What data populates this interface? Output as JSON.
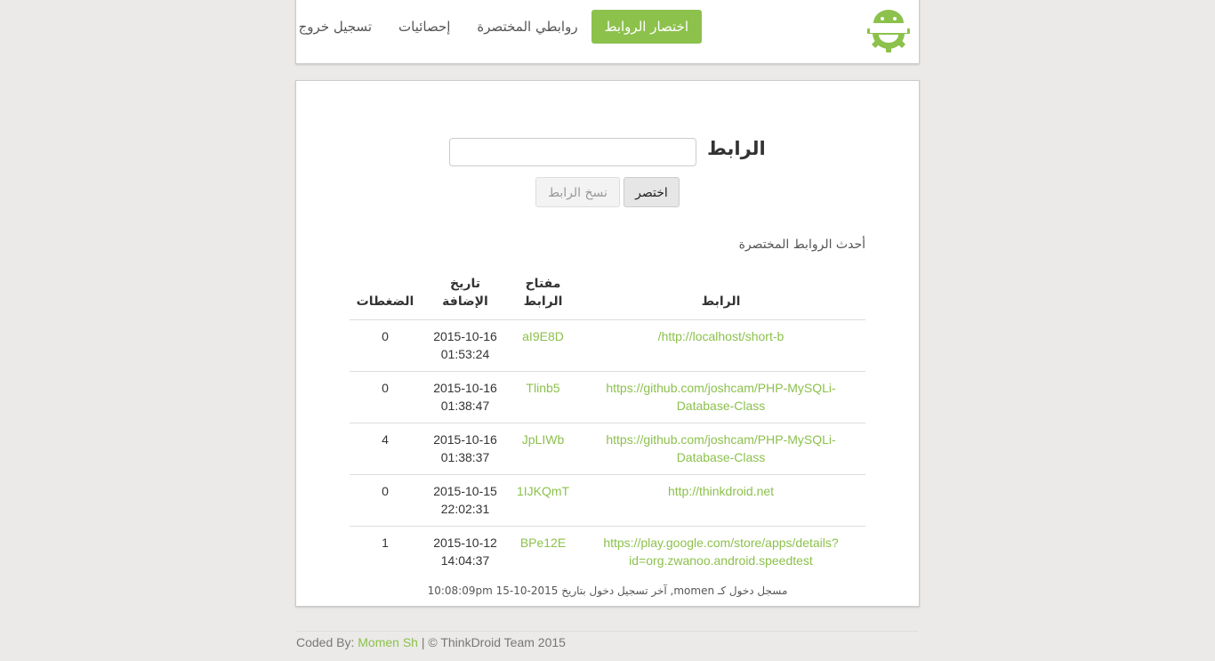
{
  "nav": {
    "logo_icon": "android-gear-logo-icon",
    "items": [
      {
        "label": "اختصار الروابط",
        "active": true
      },
      {
        "label": "روابطي المختصرة",
        "active": false
      },
      {
        "label": "إحصائيات",
        "active": false
      },
      {
        "label": "تسجيل خروج",
        "active": false
      }
    ]
  },
  "form": {
    "url_label": "الرابط",
    "url_value": "",
    "shorten_label": "اختصر",
    "copy_label": "نسخ الرابط"
  },
  "recent": {
    "title": "أحدث الروابط المختصرة",
    "headers": {
      "url": "الرابط",
      "key": "مفتاح الرابط",
      "date": "تاريخ الإضافة",
      "clicks": "الضغطات"
    },
    "rows": [
      {
        "url": "http://localhost/short-b/",
        "key": "aI9E8D",
        "date": "2015-10-16",
        "time": "01:53:24",
        "clicks": "0"
      },
      {
        "url": "https://github.com/joshcam/PHP-MySQLi-Database-Class",
        "key": "Tlinb5",
        "date": "2015-10-16",
        "time": "01:38:47",
        "clicks": "0"
      },
      {
        "url": "https://github.com/joshcam/PHP-MySQLi-Database-Class",
        "key": "JpLIWb",
        "date": "2015-10-16",
        "time": "01:38:37",
        "clicks": "4"
      },
      {
        "url": "http://thinkdroid.net",
        "key": "1IJKQmT",
        "date": "2015-10-15",
        "time": "22:02:31",
        "clicks": "0"
      },
      {
        "url": "https://play.google.com/store/apps/details?id=org.zwanoo.android.speedtest",
        "key": "BPe12E",
        "date": "2015-10-12",
        "time": "14:04:37",
        "clicks": "1"
      }
    ]
  },
  "login_info": "مسجل دخول كـ momen, آخر تسجيل دخول بتاريخ 2015-10-15 10:08:09pm",
  "footer": {
    "coded_by": "Coded By:",
    "author": "Momen Sh",
    "rest": "| © ThinkDroid Team 2015"
  },
  "colors": {
    "accent": "#8cc14c",
    "background": "#ebeae8"
  }
}
